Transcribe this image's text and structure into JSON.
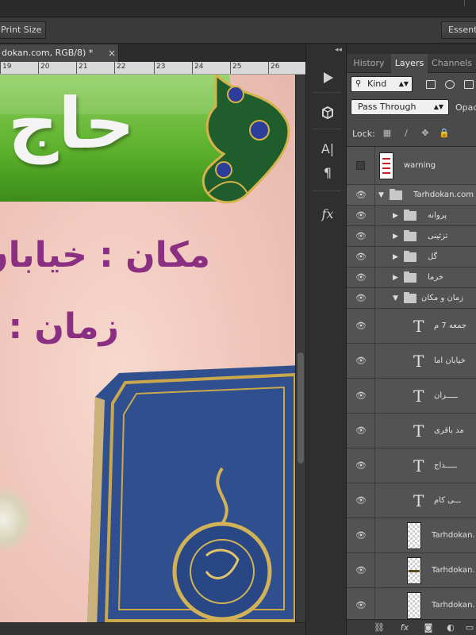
{
  "options_bar": {
    "print_size_label": "Print Size",
    "essentials_label": "Essentials"
  },
  "document": {
    "tab_title": "dokan.com, RGB/8) *",
    "close_glyph": "×",
    "ruler_numbers": [
      "19",
      "20",
      "21",
      "22",
      "23",
      "24",
      "25",
      "26"
    ]
  },
  "artwork": {
    "title_text": "حاج",
    "place_text": "مکان : خیابان",
    "time_text": "زمان :"
  },
  "tools": {
    "collapse_glyph": "◂◂",
    "items": [
      "play-icon",
      "cube-3d-icon",
      "character-icon",
      "paragraph-icon",
      "fx-icon"
    ],
    "character_glyph": "A|",
    "paragraph_glyph": "¶",
    "fx_glyph": "fx"
  },
  "layers_panel": {
    "tabs": [
      "History",
      "Layers",
      "Channels"
    ],
    "active_tab": "Layers",
    "filter_kind": "Kind",
    "blend_mode": "Pass Through",
    "opacity_label": "Opac",
    "lock_label": "Lock:",
    "layers": [
      {
        "name": "warning",
        "type": "image-warning",
        "visible": false
      },
      {
        "name": "Tarhdokan.com",
        "type": "group-open",
        "visible": true
      },
      {
        "name": "پروانه",
        "type": "group",
        "visible": true
      },
      {
        "name": "تزئینی",
        "type": "group",
        "visible": true
      },
      {
        "name": "گل",
        "type": "group",
        "visible": true
      },
      {
        "name": "خرما",
        "type": "group",
        "visible": true
      },
      {
        "name": "زمان و مکان",
        "type": "group-open-sub",
        "visible": true
      },
      {
        "name": "جمعه 7 م",
        "type": "text",
        "visible": true
      },
      {
        "name": "خیابان اما",
        "type": "text",
        "visible": true
      },
      {
        "name": "ـــــران",
        "type": "text",
        "visible": true
      },
      {
        "name": "مد باقری",
        "type": "text",
        "visible": true
      },
      {
        "name": "ـــــداج",
        "type": "text",
        "visible": true
      },
      {
        "name": "ـــی کام",
        "type": "text",
        "visible": true
      },
      {
        "name": "Tarhdokan.",
        "type": "image",
        "visible": true
      },
      {
        "name": "Tarhdokan.",
        "type": "image",
        "visible": true
      },
      {
        "name": "Tarhdokan.",
        "type": "image",
        "visible": true
      }
    ]
  },
  "colors": {
    "accent_green": "#5cb02c",
    "text_purple": "#8a2f82",
    "book_blue": "#2f4f8f"
  }
}
